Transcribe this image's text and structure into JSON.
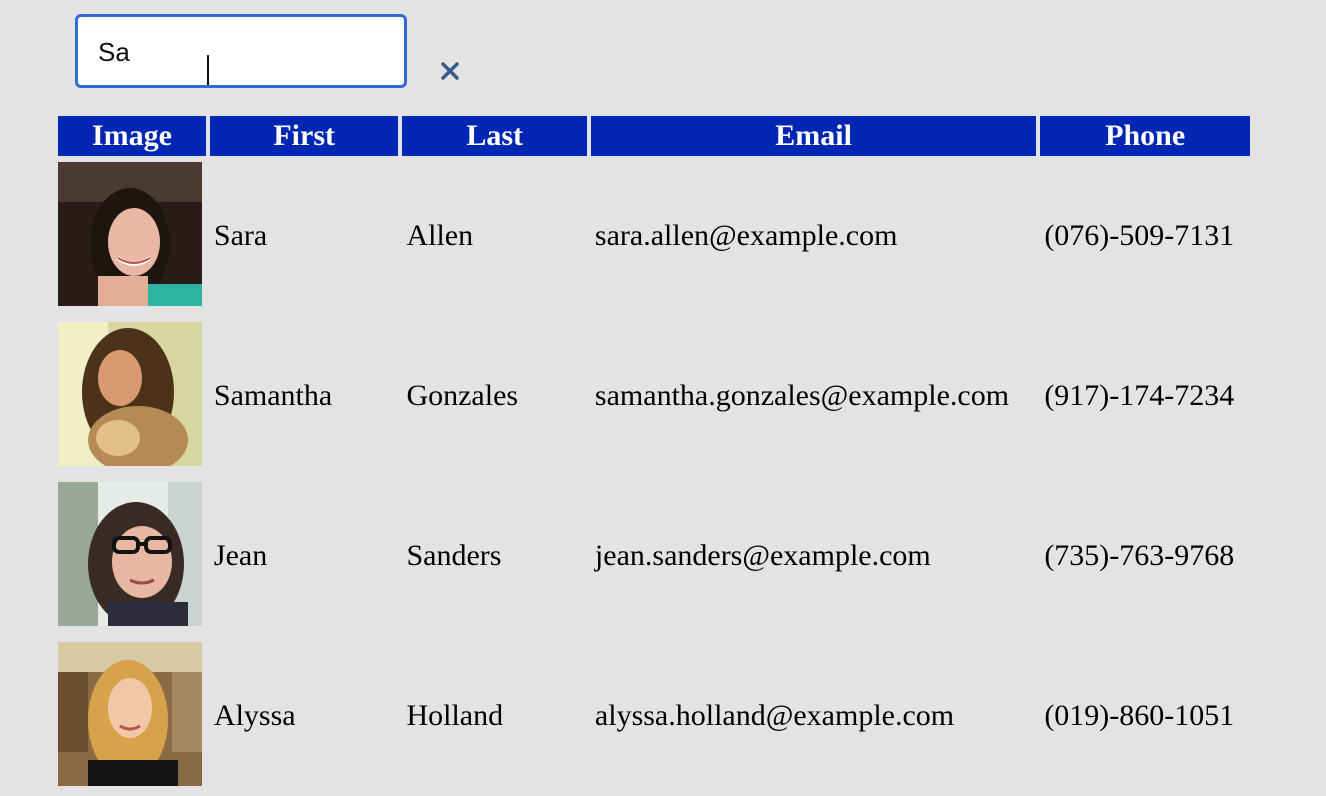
{
  "search": {
    "value": "Sa",
    "clear_icon": "close-icon"
  },
  "table": {
    "headers": [
      "Image",
      "First",
      "Last",
      "Email",
      "Phone"
    ],
    "rows": [
      {
        "first": "Sara",
        "last": "Allen",
        "email": "sara.allen@example.com",
        "phone": "(076)-509-7131",
        "photo": "portrait-dark-hair-smiling"
      },
      {
        "first": "Samantha",
        "last": "Gonzales",
        "email": "samantha.gonzales@example.com",
        "phone": "(917)-174-7234",
        "photo": "portrait-sepia-long-hair"
      },
      {
        "first": "Jean",
        "last": "Sanders",
        "email": "jean.sanders@example.com",
        "phone": "(735)-763-9768",
        "photo": "portrait-glasses"
      },
      {
        "first": "Alyssa",
        "last": "Holland",
        "email": "alyssa.holland@example.com",
        "phone": "(019)-860-1051",
        "photo": "portrait-blonde"
      }
    ]
  },
  "colors": {
    "page_bg": "#e3e3e3",
    "header_bg": "#0026b3",
    "header_text": "#ffffff",
    "search_border": "#2f6bd1",
    "clear_icon": "#3a5a8c"
  }
}
